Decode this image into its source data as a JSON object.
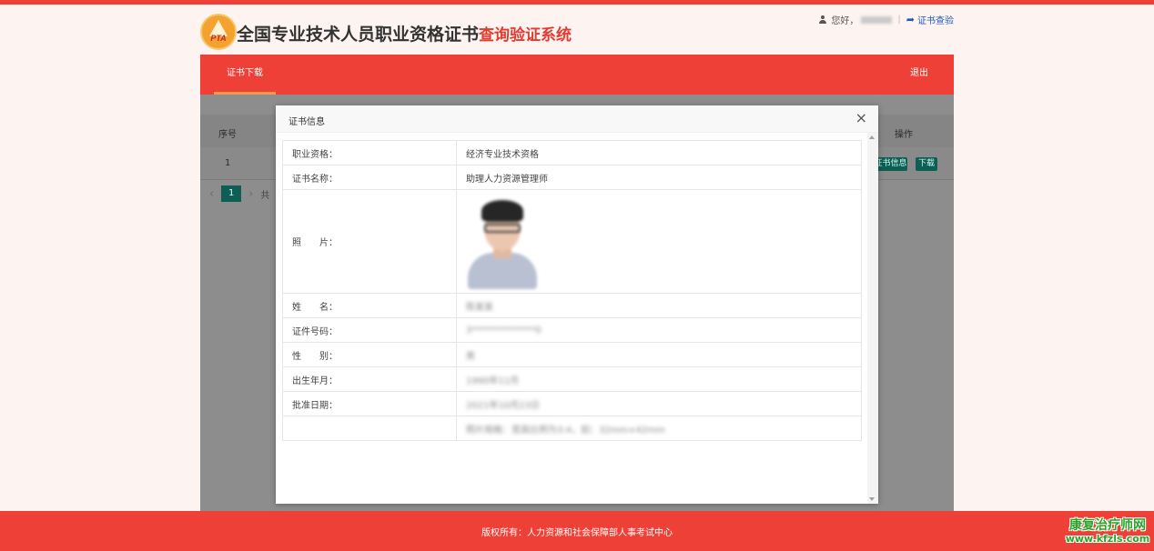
{
  "header": {
    "logo_text": "PTA",
    "title_main": "全国专业技术人员职业资格证书",
    "title_sub": "查询验证系统",
    "greeting": "您好，",
    "separator": "|",
    "verify_link": "证书查验"
  },
  "nav": {
    "active_tab": "证书下载",
    "logout": "退出"
  },
  "list_table": {
    "headers": {
      "seq": "序号",
      "operation": "操作"
    },
    "rows": [
      {
        "seq": "1",
        "info_button": "证书信息",
        "download_button": "下载"
      }
    ],
    "pager": {
      "prev": "‹",
      "current": "1",
      "next": "›",
      "total_prefix": "共"
    }
  },
  "modal": {
    "title": "证书信息",
    "close": "×",
    "rows": [
      {
        "label": "职业资格：",
        "value": "经济专业技术资格"
      },
      {
        "label": "证书名称：",
        "value": "助理人力资源管理师"
      },
      {
        "label": "照　　片：",
        "value": ""
      },
      {
        "label": "姓　　名：",
        "value": "陈某某"
      },
      {
        "label": "证件号码：",
        "value": "3**************0"
      },
      {
        "label": "性　　别：",
        "value": "男"
      },
      {
        "label": "出生年月：",
        "value": "1990年11月"
      },
      {
        "label": "批准日期：",
        "value": "2021年10月23日"
      },
      {
        "label": "",
        "value": "照片规格：宽高比例为3:4，如：32mm×42mm"
      }
    ]
  },
  "footer": {
    "copyright": "版权所有：人力资源和社会保障部人事考试中心"
  },
  "watermark": {
    "line1": "康复治疗师网",
    "line2": "www.kfzls.com"
  },
  "colors": {
    "brand_red": "#ee4036",
    "accent_orange": "#f39c4e",
    "link_blue": "#1e5bb8",
    "button_teal": "#0e5e55",
    "watermark_green": "#2ba329"
  }
}
